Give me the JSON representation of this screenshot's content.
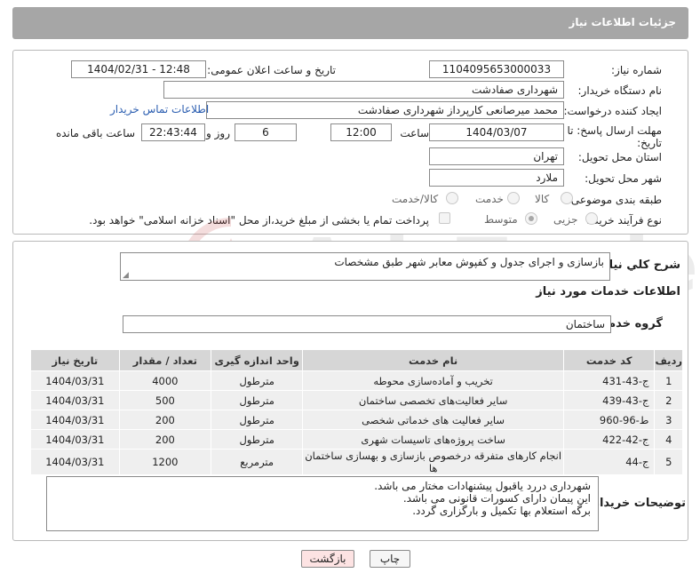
{
  "header": {
    "title": "جزئیات اطلاعات نیاز"
  },
  "fields": {
    "need_number_label": "شماره نیاز:",
    "need_number": "1104095653000033",
    "announce_label": "تاریخ و ساعت اعلان عمومی:",
    "announce_value": "1404/02/31 - 12:48",
    "buyer_org_label": "نام دستگاه خریدار:",
    "buyer_org": "شهرداری صفادشت",
    "creator_label": "ایجاد کننده درخواست:",
    "creator": "محمد میرصانعی کارپرداز شهرداری صفادشت",
    "contact_link": "اطلاعات تماس خریدار",
    "deadline_label_1": "مهلت ارسال پاسخ: تا",
    "deadline_label_2": "تاریخ:",
    "deadline_date": "1404/03/07",
    "time_label": "ساعت",
    "deadline_time": "12:00",
    "days_value": "6",
    "days_label": "روز و",
    "remaining_time": "22:43:44",
    "remaining_label": "ساعت باقی مانده",
    "province_label": "استان محل تحویل:",
    "province": "تهران",
    "city_label": "شهر محل تحویل:",
    "city": "ملارد",
    "category_label": "طبقه بندی موضوعی:",
    "category_options": [
      "کالا",
      "خدمت",
      "کالا/خدمت"
    ],
    "process_label": "نوع فرآیند خرید :",
    "process_options": [
      "جزیی",
      "متوسط"
    ],
    "payment_note": "پرداخت تمام یا بخشی از مبلغ خرید،از محل \"اسناد خزانه اسلامی\" خواهد بود."
  },
  "summary": {
    "label": "شرح کلي نياز:",
    "value": "بازسازی و اجرای جدول و کفپوش معابر شهر طبق مشخصات"
  },
  "services": {
    "section_title": "اطلاعات خدمات مورد نیاز",
    "group_label": "گروه خدمت:",
    "group_value": "ساختمان"
  },
  "table": {
    "columns": [
      "ردیف",
      "کد خدمت",
      "نام خدمت",
      "واحد اندازه گیری",
      "تعداد / مقدار",
      "تاریخ نیاز"
    ],
    "rows": [
      [
        "1",
        "ج-43-431",
        "تخریب و آماده‌سازی محوطه",
        "مترطول",
        "4000",
        "1404/03/31"
      ],
      [
        "2",
        "ج-43-439",
        "سایر فعالیت‌های تخصصی ساختمان",
        "مترطول",
        "500",
        "1404/03/31"
      ],
      [
        "3",
        "ط-96-960",
        "سایر فعالیت های خدماتی شخصی",
        "مترطول",
        "200",
        "1404/03/31"
      ],
      [
        "4",
        "ج-42-422",
        "ساخت پروژه‌های تاسیسات شهری",
        "مترطول",
        "200",
        "1404/03/31"
      ],
      [
        "5",
        "ج-44",
        "انجام کارهای متفرقه درخصوص بازسازی و بهسازی ساختمان ها",
        "مترمربع",
        "1200",
        "1404/03/31"
      ]
    ]
  },
  "notes": {
    "label": "توضیحات خریدار:",
    "lines": [
      "شهرداری دررد یاقبول پیشنهادات مختار می باشد.",
      "این پیمان دارای کسورات قانونی می باشد.",
      "برگه استعلام بها تکمیل و بارگزاری گردد."
    ]
  },
  "buttons": {
    "print": "چاپ",
    "back": "بازگشت"
  },
  "watermark": {
    "text": "AriaTender.neT"
  },
  "colors": {
    "header_bg": "#a6a6a6",
    "table_header_bg": "#d6d6d6",
    "table_row_bg": "#efefef",
    "link": "#2a5db0",
    "back_button_bg": "#fde3e3"
  }
}
